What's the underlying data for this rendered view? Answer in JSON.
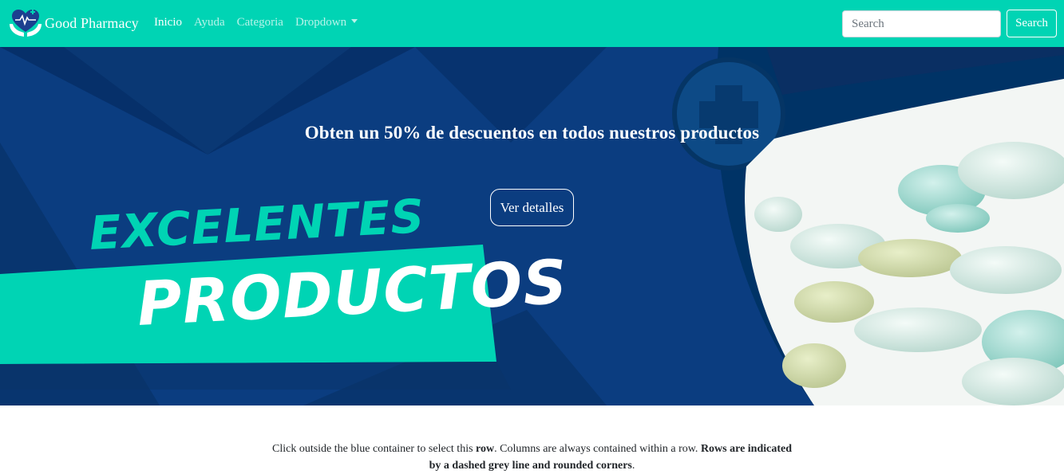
{
  "navbar": {
    "brand": "Good Pharmacy",
    "brand_icon": "heart-hands-logo-icon",
    "links": [
      {
        "label": "Inicio",
        "active": true
      },
      {
        "label": "Ayuda",
        "active": false
      },
      {
        "label": "Categoria",
        "active": false
      },
      {
        "label": "Dropdown",
        "active": false,
        "dropdown": true
      }
    ],
    "search_placeholder": "Search",
    "search_button": "Search"
  },
  "hero": {
    "title": "Obten un 50% de descuentos en todos nuestros productos",
    "button": "Ver detalles",
    "promo_line1": "EXCELENTES",
    "promo_line2": "PRODUCTOS"
  },
  "content": {
    "note_part1": "Click outside the blue container to select this ",
    "note_bold1": "row",
    "note_part2": ". Columns are always contained within a row. ",
    "note_bold2": "Rows are indicated by a dashed grey line and rounded corners",
    "note_part3": "."
  },
  "colors": {
    "navbar_bg": "#00d4b4",
    "hero_bg": "#0a3c7e",
    "accent_teal": "#00d4b4"
  }
}
